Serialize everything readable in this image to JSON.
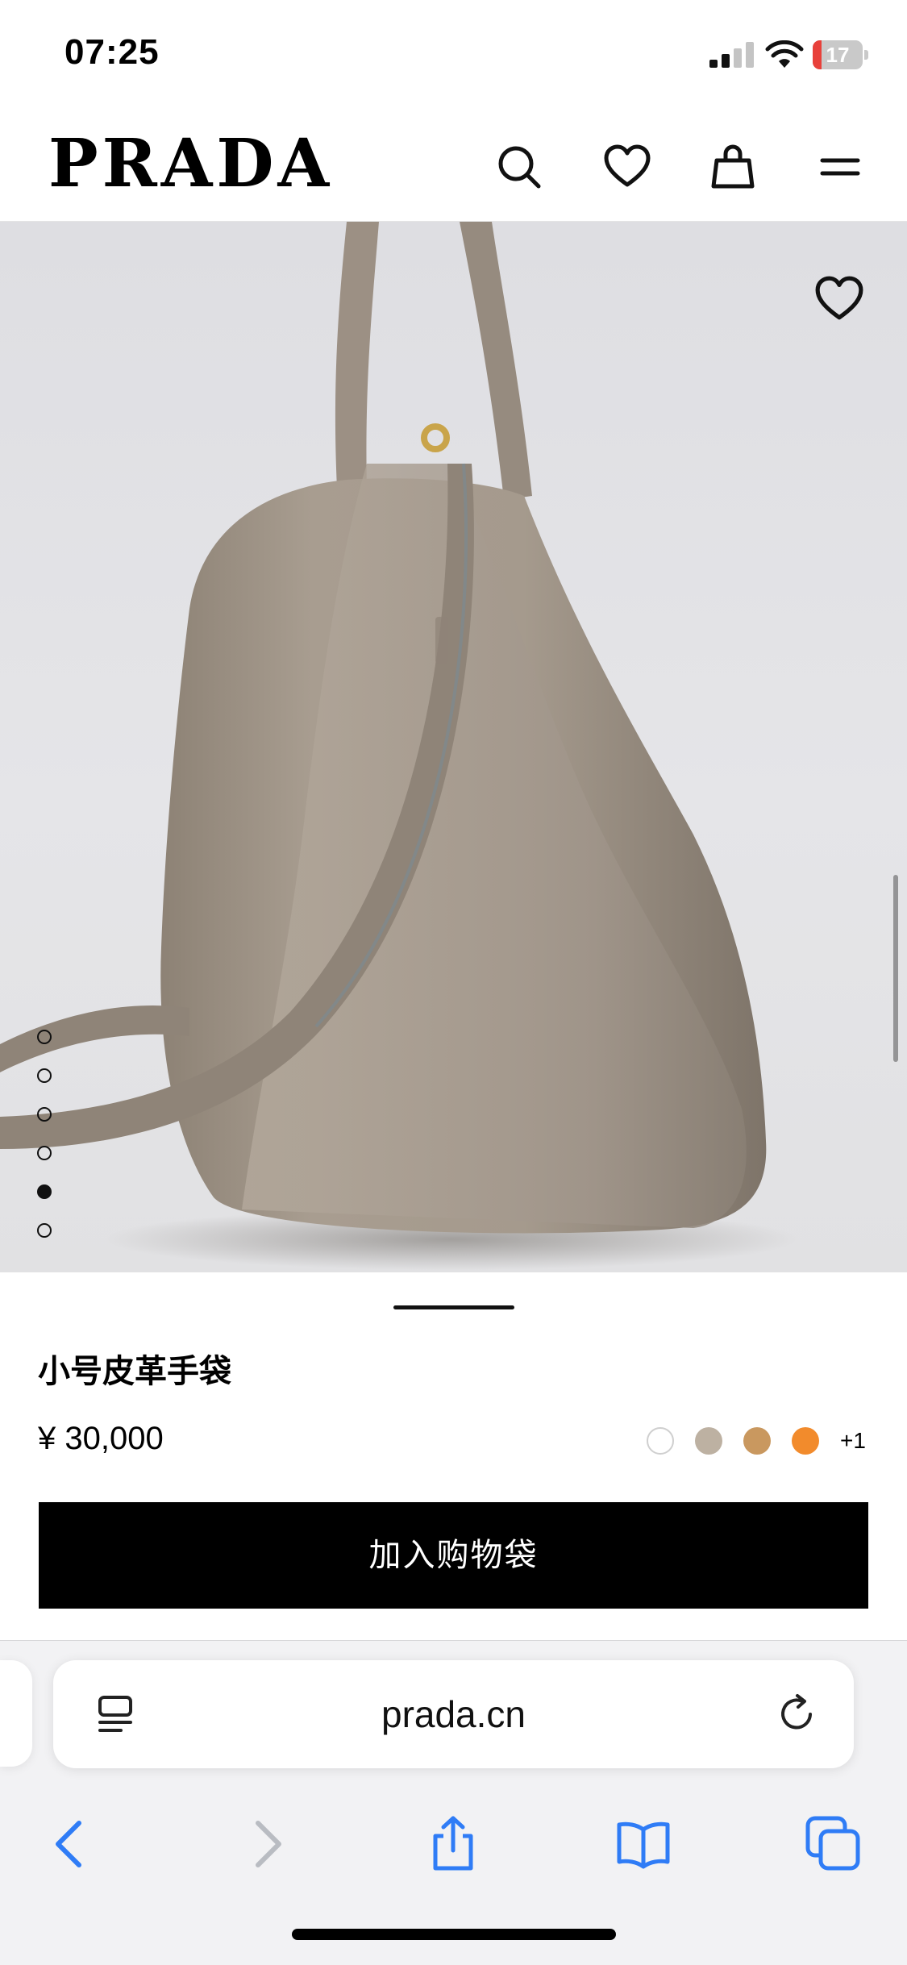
{
  "status_bar": {
    "time": "07:25",
    "battery_percent": "17",
    "battery_level": 0.17,
    "icons": [
      "cellular-signal-icon",
      "wifi-icon",
      "battery-icon"
    ]
  },
  "header": {
    "logo": "PRADA",
    "icons": [
      "search-icon",
      "heart-icon",
      "shopping-bag-icon",
      "menu-icon"
    ]
  },
  "gallery": {
    "favorite_icon": "heart-outline-icon",
    "dot_count": 6,
    "active_dot": 5
  },
  "product": {
    "name": "小号皮革手袋",
    "price": "¥ 30,000",
    "swatches": [
      "#ffffff",
      "#bdb1a2",
      "#c9985f",
      "#f28b2c"
    ],
    "swatches_more": "+1",
    "add_to_bag": "加入购物袋"
  },
  "browser": {
    "address": "prada.cn",
    "icons": [
      "page-menu-icon",
      "reload-icon",
      "back-icon",
      "forward-icon",
      "share-icon",
      "bookmarks-icon",
      "tabs-icon"
    ]
  },
  "colors": {
    "accent_blue": "#2f7cf6",
    "button_black": "#000000",
    "bag_taupe": "#a69a8c"
  }
}
